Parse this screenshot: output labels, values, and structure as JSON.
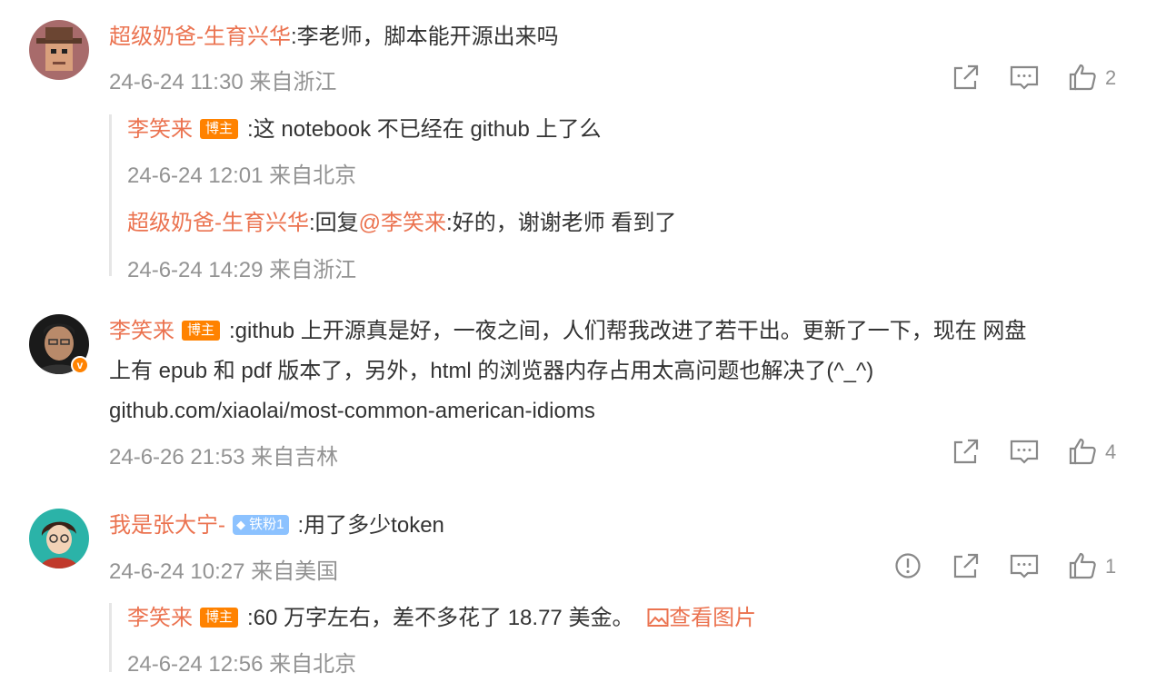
{
  "comments": [
    {
      "author": "超级奶爸-生育兴华",
      "text": ":李老师，脚本能开源出来吗",
      "meta": "24-6-24 11:30 来自浙江",
      "likes": "2",
      "replies": [
        {
          "author": "李笑来",
          "badge": "博主",
          "text": ":这 notebook 不已经在 github 上了么",
          "meta": "24-6-24 12:01 来自北京"
        },
        {
          "author": "超级奶爸-生育兴华",
          "reply_prefix": ":回复",
          "mention": "@李笑来",
          "text": ":好的，谢谢老师 看到了",
          "meta": "24-6-24 14:29 来自浙江"
        }
      ]
    },
    {
      "author": "李笑来",
      "badge": "博主",
      "lines": [
        ":github 上开源真是好，一夜之间，人们帮我改进了若干出。更新了一下，现在 网盘",
        "上有 epub 和 pdf 版本了，另外，html 的浏览器内存占用太高问题也解决了(^_^)",
        "github.com/xiaolai/most-common-american-idioms"
      ],
      "meta": "24-6-26 21:53 来自吉林",
      "likes": "4",
      "avatar_badge": "v"
    },
    {
      "author": "我是张大宁-",
      "fan_badge": "铁粉1",
      "text": ":用了多少token",
      "meta": "24-6-24 10:27 来自美国",
      "likes": "1",
      "replies": [
        {
          "author": "李笑来",
          "badge": "博主",
          "text": ":60 万字左右，差不多花了 18.77 美金。",
          "image_link": "查看图片",
          "meta": "24-6-24 12:56 来自北京"
        }
      ]
    }
  ],
  "colors": {
    "name": "#eb7350",
    "meta": "#939393",
    "badge": "#ff8200",
    "fan_badge": "#8cc2ff"
  },
  "icons": [
    "share-icon",
    "comment-icon",
    "like-icon",
    "report-icon",
    "image-icon"
  ]
}
